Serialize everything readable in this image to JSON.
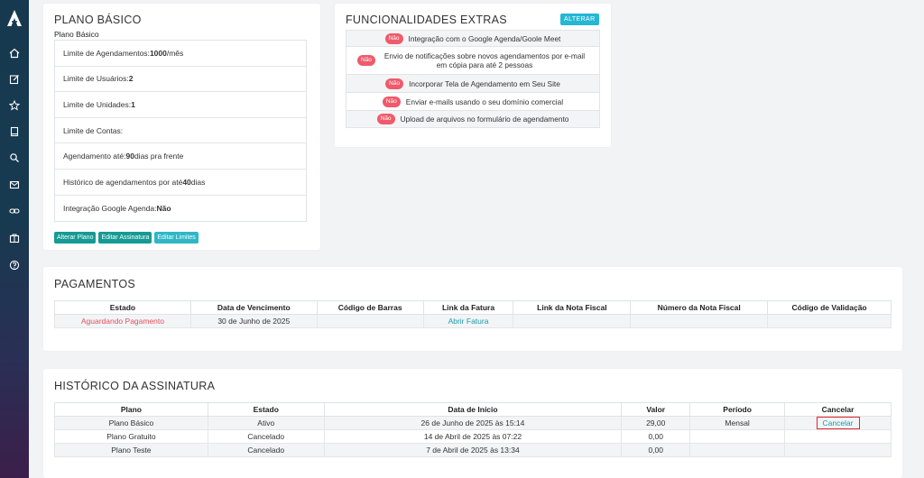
{
  "sidebar": {
    "icons": [
      "logo-a-icon",
      "home-icon",
      "edit-icon",
      "star-icon",
      "book-icon",
      "search-icon",
      "mail-icon",
      "link-icon",
      "briefcase-icon",
      "help-icon"
    ]
  },
  "plan": {
    "title": "PLANO BÁSICO",
    "subtitle": "Plano Básico",
    "limits": [
      {
        "label": "Limite de Agendamentos: ",
        "value": "1000",
        "suffix": "/mês"
      },
      {
        "label": "Limite de Usuários: ",
        "value": "2",
        "suffix": ""
      },
      {
        "label": "Limite de Unidades: ",
        "value": "1",
        "suffix": ""
      },
      {
        "label": "Limite de Contas:",
        "value": "",
        "suffix": ""
      },
      {
        "label": "Agendamento até: ",
        "value": "90",
        "suffix": " dias pra frente"
      },
      {
        "label": "Histórico de agendamentos por até ",
        "value": "40",
        "suffix": " dias"
      },
      {
        "label": "Integração Google Agenda: ",
        "value": "Não",
        "suffix": ""
      }
    ],
    "buttons": [
      "Alterar Plano",
      "Editar Assinatura",
      "Editar Limites"
    ]
  },
  "extras": {
    "title": "FUNCIONALIDADES EXTRAS",
    "alter_label": "ALTERAR",
    "items": [
      {
        "badge": "Não",
        "text": "Integração com o Google Agenda/Goole Meet"
      },
      {
        "badge": "Não",
        "text": "Envio de notificações sobre novos agendamentos por e-mail em cópia para até 2 pessoas"
      },
      {
        "badge": "Não",
        "text": "Incorporar Tela de Agendamento em Seu Site"
      },
      {
        "badge": "Não",
        "text": "Enviar e-mails usando o seu domínio comercial"
      },
      {
        "badge": "Não",
        "text": "Upload de arquivos no formulário de agendamento"
      }
    ]
  },
  "payments": {
    "title": "PAGAMENTOS",
    "headers": [
      "Estado",
      "Data de Vencimento",
      "Código de Barras",
      "Link da Fatura",
      "Link da Nota Fiscal",
      "Número da Nota Fiscal",
      "Código de Validação"
    ],
    "rows": [
      {
        "estado": "Aguardando Pagamento",
        "vencimento": "30 de Junho de 2025",
        "barras": "",
        "fatura": "Abrir Fatura",
        "nota_link": "",
        "nota_numero": "",
        "validacao": ""
      }
    ]
  },
  "history": {
    "title": "HISTÓRICO DA ASSINATURA",
    "headers": [
      "Plano",
      "Estado",
      "Data de Início",
      "Valor",
      "Período",
      "Cancelar"
    ],
    "rows": [
      {
        "plano": "Plano Básico",
        "estado": "Ativo",
        "inicio": "26 de Junho de 2025 às 15:14",
        "valor": "29,00",
        "periodo": "Mensal",
        "cancelar": "Cancelar"
      },
      {
        "plano": "Plano Gratuito",
        "estado": "Cancelado",
        "inicio": "14 de Abril de 2025 às 07:22",
        "valor": "0,00",
        "periodo": "",
        "cancelar": ""
      },
      {
        "plano": "Plano Teste",
        "estado": "Cancelado",
        "inicio": "7 de Abril de 2025 às 13:34",
        "valor": "0,00",
        "periodo": "",
        "cancelar": ""
      }
    ]
  },
  "colors": {
    "accent_teal": "#169a94",
    "info_blue": "#25b7d3",
    "danger_red": "#ef5b6b"
  }
}
